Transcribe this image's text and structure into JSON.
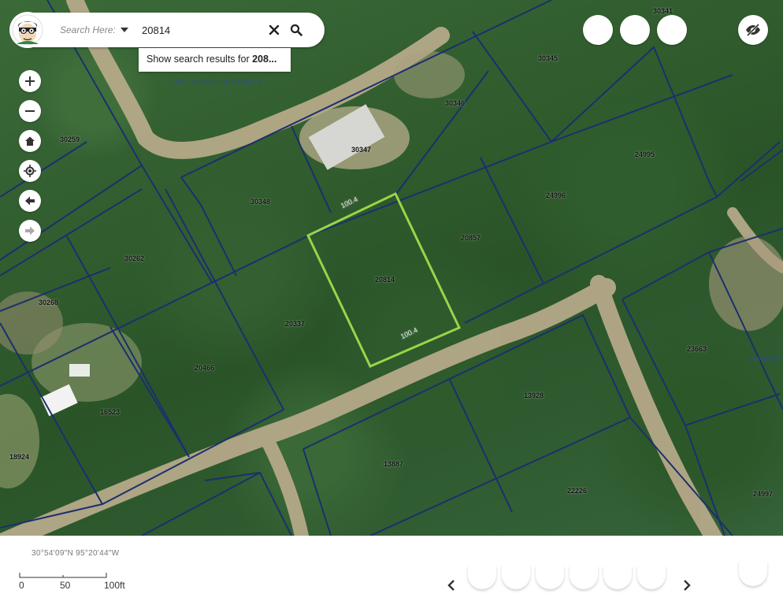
{
  "search": {
    "placeholder_label": "Search Here:",
    "value": "20814",
    "suggestion_prefix": "Show search results for ",
    "suggestion_term": "208..."
  },
  "map": {
    "subdivision_label": "LAKE ACRES SECTION B",
    "subdivision_label_right": "HARBES",
    "selected_parcel": "20814",
    "selected_outline_color": "#9bd44a",
    "parcel_line_color": "#1c2f6e",
    "parcels": [
      "30341",
      "30345",
      "30346",
      "30347",
      "30348",
      "30259",
      "30262",
      "30268",
      "20337",
      "20466",
      "16523",
      "18924",
      "24995",
      "24996",
      "20857",
      "20814",
      "13928",
      "13887",
      "22226",
      "24997",
      "23663"
    ],
    "dimensions": [
      "100.4",
      "100.4"
    ]
  },
  "tools": [
    {
      "name": "zoom-in",
      "icon": "plus-icon"
    },
    {
      "name": "zoom-out",
      "icon": "minus-icon"
    },
    {
      "name": "home",
      "icon": "home-icon"
    },
    {
      "name": "locate",
      "icon": "crosshair-icon"
    },
    {
      "name": "back",
      "icon": "arrow-left-icon"
    },
    {
      "name": "forward",
      "icon": "arrow-right-icon"
    }
  ],
  "footer": {
    "coordinates": "30°54'09\"N 95°20'44\"W",
    "scale_labels": [
      "0",
      "50",
      "100ft"
    ]
  }
}
